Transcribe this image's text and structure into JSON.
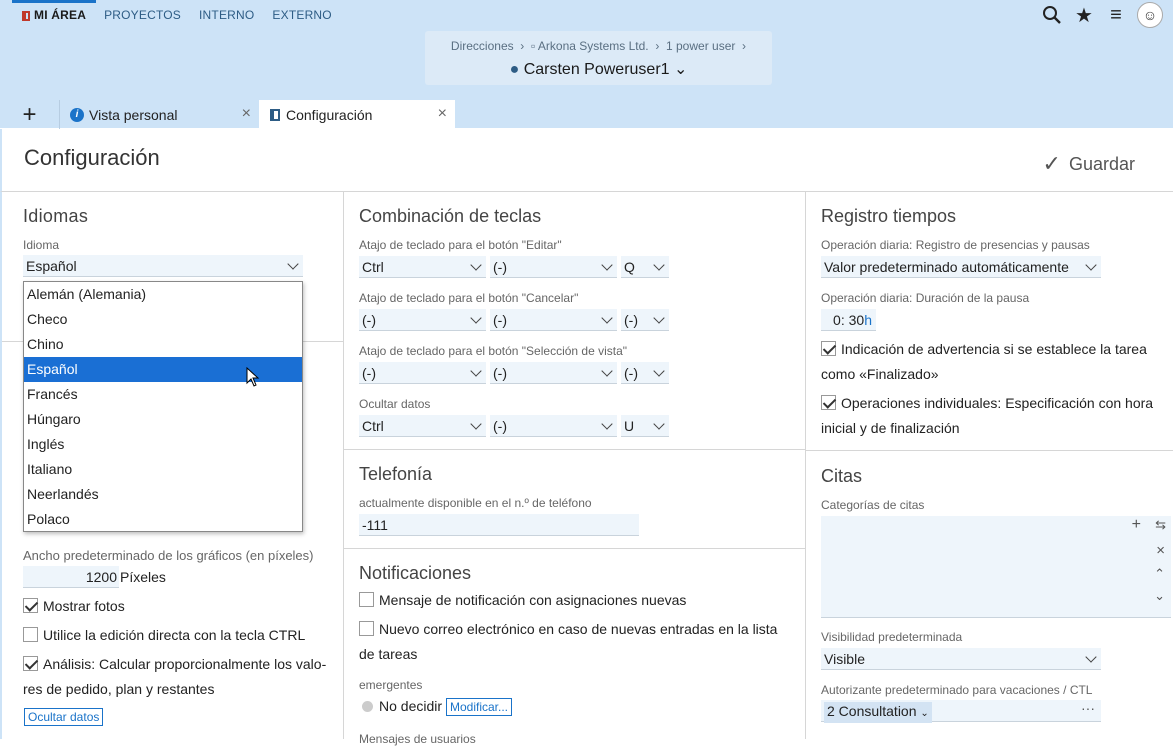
{
  "nav": {
    "items": [
      "MI ÁREA",
      "PROYECTOS",
      "INTERNO",
      "EXTERNO"
    ]
  },
  "breadcrumb": {
    "items": [
      "Direcciones",
      "Arkona Systems Ltd.",
      "1 power user"
    ],
    "user": "Carsten Poweruser1"
  },
  "tabs": [
    {
      "label": "Vista personal"
    },
    {
      "label": "Configuración"
    }
  ],
  "page": {
    "title": "Configuración",
    "save": "Guardar"
  },
  "idiomas": {
    "title": "Idiomas",
    "label": "Idioma",
    "value": "Español",
    "options": [
      "Alemán (Alemania)",
      "Checo",
      "Chino",
      "Español",
      "Francés",
      "Húngaro",
      "Inglés",
      "Italiano",
      "Neerlandés",
      "Polaco"
    ],
    "selected_index": 3
  },
  "general": {
    "chart_width_label": "Ancho predeterminado de los gráficos (en píxeles)",
    "chart_width_value": "1200",
    "chart_width_unit": "Píxeles",
    "show_photos": "Mostrar fotos",
    "direct_edit": "Utilice la edición directa con la tecla CTRL",
    "analysis_1": "Análisis: Calcular proporcionalmente los valo-",
    "analysis_2": "res de pedido, plan y restantes",
    "hide_button": "Ocultar datos"
  },
  "teclas": {
    "title": "Combinación de teclas",
    "rows": [
      {
        "label": "Atajo de teclado para el botón \"Editar\"",
        "a": "Ctrl",
        "b": "(-)",
        "c": "Q"
      },
      {
        "label": "Atajo de teclado para el botón \"Cancelar\"",
        "a": "(-)",
        "b": "(-)",
        "c": "(-)"
      },
      {
        "label": "Atajo de teclado para el botón \"Selección de vista\"",
        "a": "(-)",
        "b": "(-)",
        "c": "(-)"
      },
      {
        "label": "Ocultar datos",
        "a": "Ctrl",
        "b": "(-)",
        "c": "U"
      }
    ]
  },
  "telefonia": {
    "title": "Telefonía",
    "label": "actualmente disponible en el n.º de teléfono",
    "value": "-111"
  },
  "notificaciones": {
    "title": "Notificaciones",
    "opt1": "Mensaje de notificación con asignaciones nuevas",
    "opt2_1": "Nuevo correo electrónico en caso de nuevas entradas en la lista",
    "opt2_2": "de tareas",
    "emergentes": "emergentes",
    "no_decidir": "No decidir",
    "modificar": "Modificar...",
    "mensajes": "Mensajes de usuarios"
  },
  "registro": {
    "title": "Registro tiempos",
    "op_label": "Operación diaria: Registro de presencias y pausas",
    "op_value": "Valor predeterminado automáticamente",
    "pause_label": "Operación diaria: Duración de la pausa",
    "pause_h": "0",
    "pause_m": "30",
    "pause_unit": "h",
    "warn_1": "Indicación de advertencia si se establece la tarea",
    "warn_2": "como «Finalizado»",
    "indiv_1": "Operaciones individuales: Especificación con hora",
    "indiv_2": "inicial y de finalización"
  },
  "citas": {
    "title": "Citas",
    "cat_label": "Categorías de citas",
    "vis_label": "Visibilidad predeterminada",
    "vis_value": "Visible",
    "auth_label": "Autorizante predeterminado para vacaciones / CTL",
    "auth_value": "2 Consultation"
  }
}
